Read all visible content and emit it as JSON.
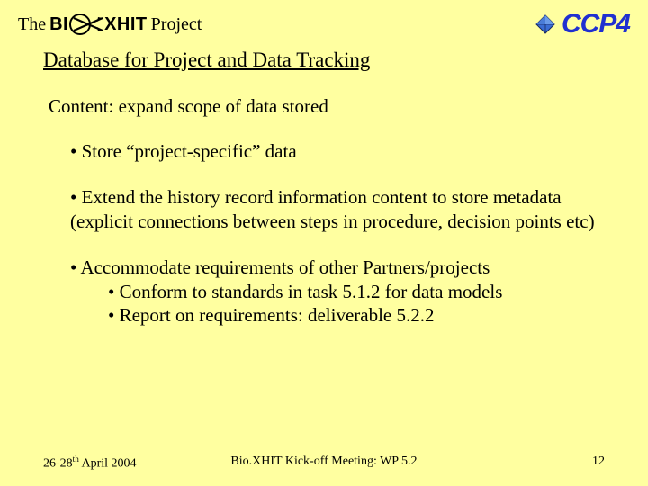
{
  "header": {
    "the": "The",
    "brand": "BI   XHIT",
    "project": "Project",
    "ccp4": "CCP4"
  },
  "title": "Database for Project and Data Tracking",
  "subtitle": "Content: expand scope of data stored",
  "bullets": {
    "b1": "• Store “project-specific” data",
    "b2": "• Extend the history record information content to store metadata (explicit connections between steps in procedure, decision points etc)",
    "b3": "• Accommodate requirements of other Partners/projects",
    "b3a": "• Conform to standards in task 5.1.2 for data models",
    "b3b": "• Report on requirements: deliverable 5.2.2"
  },
  "footer": {
    "date_pre": "26-28",
    "date_sup": "th",
    "date_post": " April 2004",
    "center": "Bio.XHIT Kick-off Meeting: WP 5.2",
    "page": "12"
  }
}
